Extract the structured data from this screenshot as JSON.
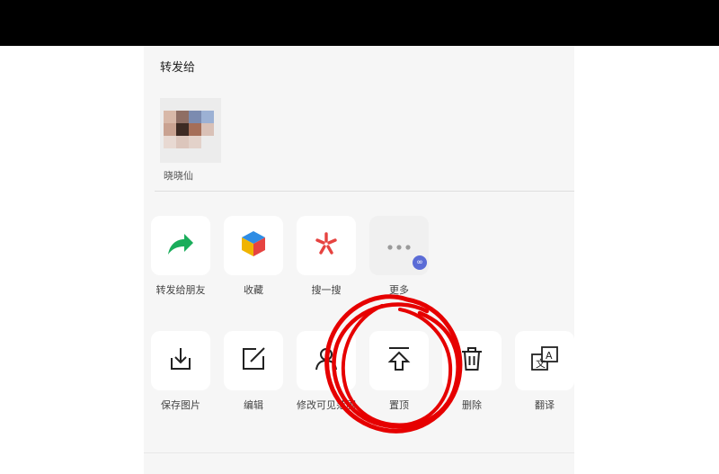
{
  "header": {
    "title": "转发给"
  },
  "recent_contacts": [
    {
      "name": "晓晓仙"
    }
  ],
  "share_actions": [
    {
      "label": "转发给朋友",
      "icon": "forward-arrow-icon",
      "color": "#1aad5b"
    },
    {
      "label": "收藏",
      "icon": "favorites-cube-icon",
      "color": "#f0b400"
    },
    {
      "label": "搜一搜",
      "icon": "search-star-icon",
      "color": "#e64340"
    },
    {
      "label": "更多",
      "icon": "more-dots-icon",
      "color": "#9a9a9a"
    }
  ],
  "tool_actions": [
    {
      "label": "保存图片",
      "icon": "download-icon"
    },
    {
      "label": "编辑",
      "icon": "edit-icon"
    },
    {
      "label": "修改可见范围",
      "icon": "visibility-person-icon"
    },
    {
      "label": "置顶",
      "icon": "pin-top-icon"
    },
    {
      "label": "删除",
      "icon": "trash-icon"
    },
    {
      "label": "翻译",
      "icon": "translate-icon"
    }
  ],
  "annotation": {
    "type": "hand-drawn circle",
    "color": "#e60000",
    "target": "置顶"
  }
}
